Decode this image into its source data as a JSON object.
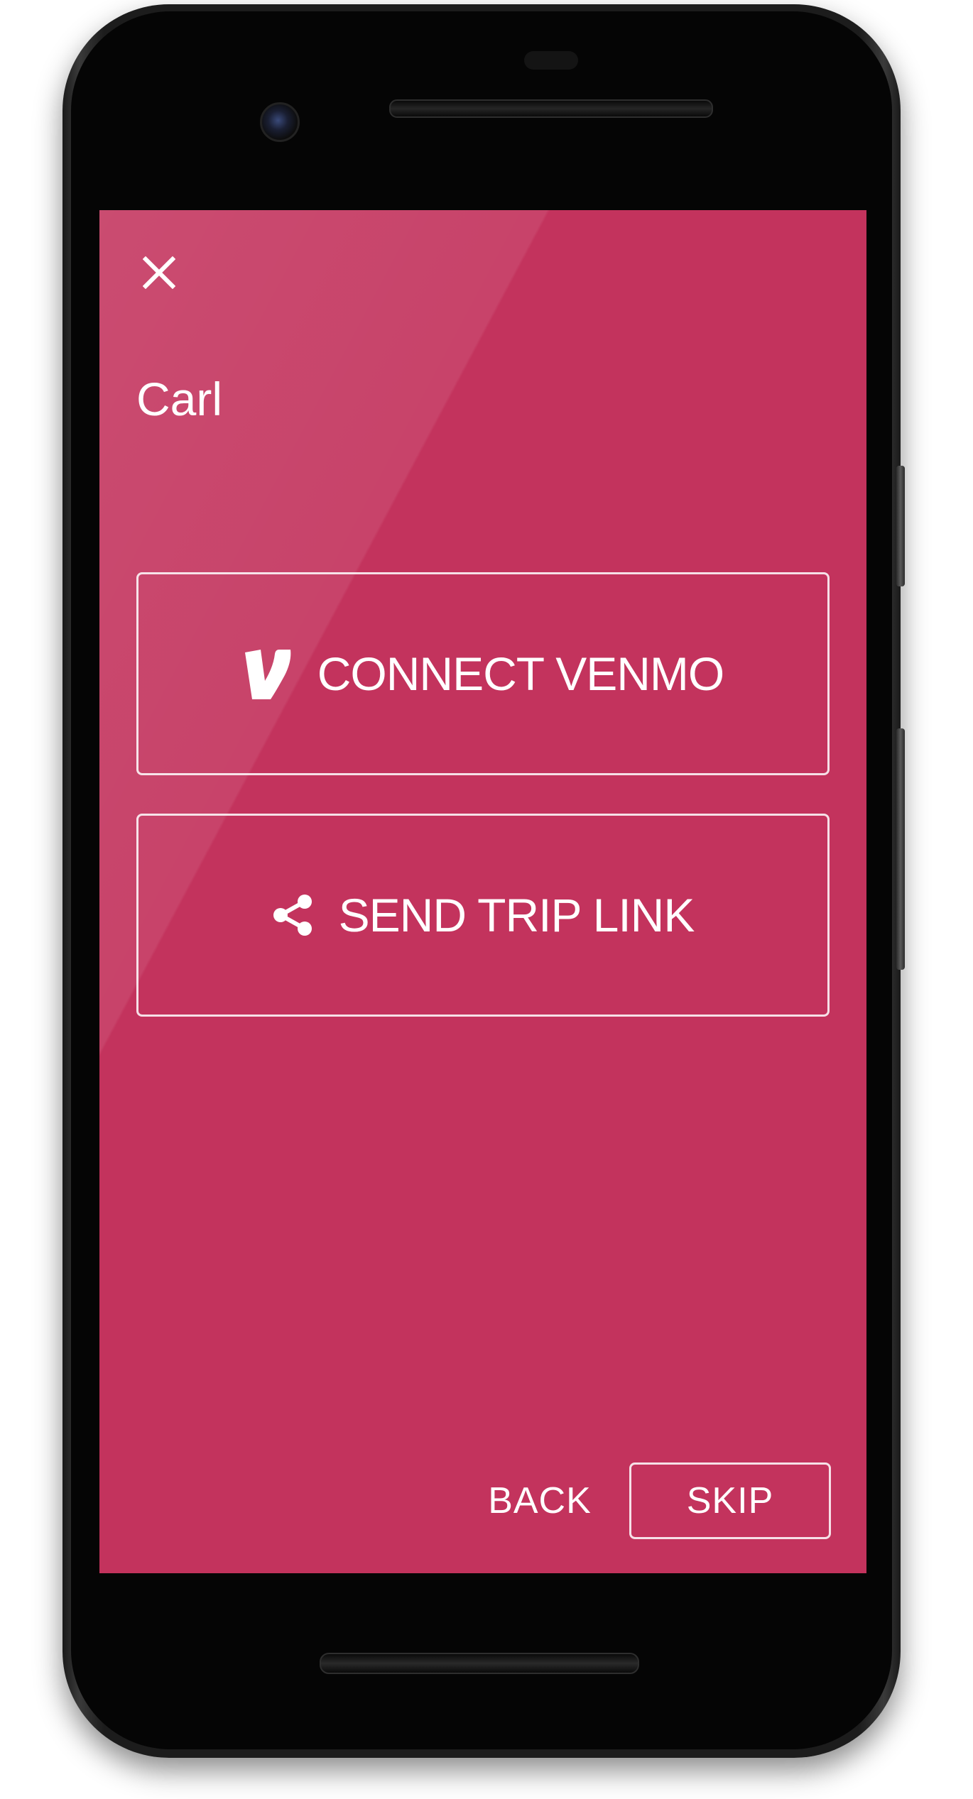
{
  "screen": {
    "background_color": "#c3335d",
    "text_color": "#ffffff",
    "close_icon": "close-icon",
    "title": "Carl"
  },
  "actions": [
    {
      "label": "CONNECT VENMO",
      "icon": "venmo-logo-icon"
    },
    {
      "label": "SEND TRIP LINK",
      "icon": "share-icon"
    }
  ],
  "footer": {
    "back_label": "BACK",
    "skip_label": "SKIP"
  }
}
